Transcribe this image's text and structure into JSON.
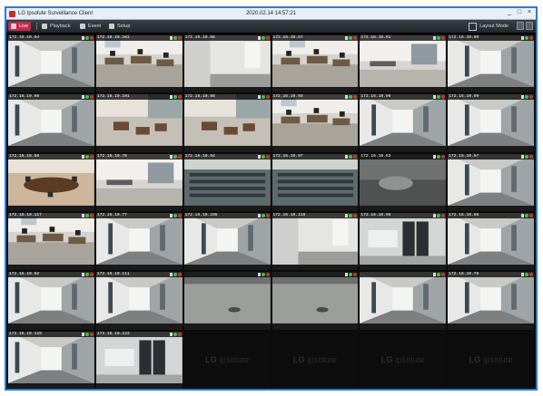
{
  "window": {
    "title": "LG Ipsolute Surveillance Client",
    "clock": "2020.02.14 14:57:21",
    "controls": [
      "_",
      "□",
      "×"
    ]
  },
  "toolbar": {
    "tabs": [
      {
        "id": "live",
        "label": "Live",
        "icon": "live-icon"
      },
      {
        "id": "playback",
        "label": "Playback",
        "icon": "playback-icon"
      },
      {
        "id": "event",
        "label": "Event",
        "icon": "event-icon"
      },
      {
        "id": "setup",
        "label": "Setup",
        "icon": "setup-icon"
      }
    ],
    "right_label": "Layout Mode",
    "active_color": "#c8294a"
  },
  "cameras": [
    {
      "name": "172.16.10.54",
      "scene": "corridor"
    },
    {
      "name": "172.16.10.101",
      "scene": "office"
    },
    {
      "name": "172.16.10.86",
      "scene": "wall"
    },
    {
      "name": "172.16.10.57",
      "scene": "office"
    },
    {
      "name": "172.16.10.91",
      "scene": "lobby"
    },
    {
      "name": "172.16.10.69",
      "scene": "corridor"
    },
    {
      "name": "172.16.10.88",
      "scene": "corridor"
    },
    {
      "name": "172.16.10.101",
      "scene": "lounge"
    },
    {
      "name": "172.16.10.98",
      "scene": "lounge"
    },
    {
      "name": "172.16.10.93",
      "scene": "office"
    },
    {
      "name": "172.16.10.96",
      "scene": "corridor"
    },
    {
      "name": "172.16.10.99",
      "scene": "corridor"
    },
    {
      "name": "172.16.10.66",
      "scene": "meeting"
    },
    {
      "name": "172.16.10.76",
      "scene": "lobby"
    },
    {
      "name": "172.16.10.64",
      "scene": "lecture"
    },
    {
      "name": "172.16.10.97",
      "scene": "lecture"
    },
    {
      "name": "172.16.10.63",
      "scene": "dark"
    },
    {
      "name": "172.16.10.67",
      "scene": "corridor"
    },
    {
      "name": "172.16.10.117",
      "scene": "office"
    },
    {
      "name": "172.16.10.77",
      "scene": "corridor"
    },
    {
      "name": "172.16.10.105",
      "scene": "corridor"
    },
    {
      "name": "172.16.10.115",
      "scene": "wall"
    },
    {
      "name": "172.16.10.95",
      "scene": "server"
    },
    {
      "name": "172.16.10.68",
      "scene": "corridor"
    },
    {
      "name": "172.16.10.92",
      "scene": "corridor"
    },
    {
      "name": "172.16.10.111",
      "scene": "corridor"
    },
    {
      "name": "",
      "scene": "floor"
    },
    {
      "name": "",
      "scene": "floor"
    },
    {
      "name": "",
      "scene": "corridor"
    },
    {
      "name": "172.16.10.79",
      "scene": "corridor"
    },
    {
      "name": "172.16.10.129",
      "scene": "corridor"
    },
    {
      "name": "172.16.10.123",
      "scene": "server"
    }
  ],
  "empty_logo": {
    "brand": "LG",
    "product": "ipsolute"
  },
  "grid": {
    "columns": 6,
    "rows": 6,
    "filled": 32
  }
}
